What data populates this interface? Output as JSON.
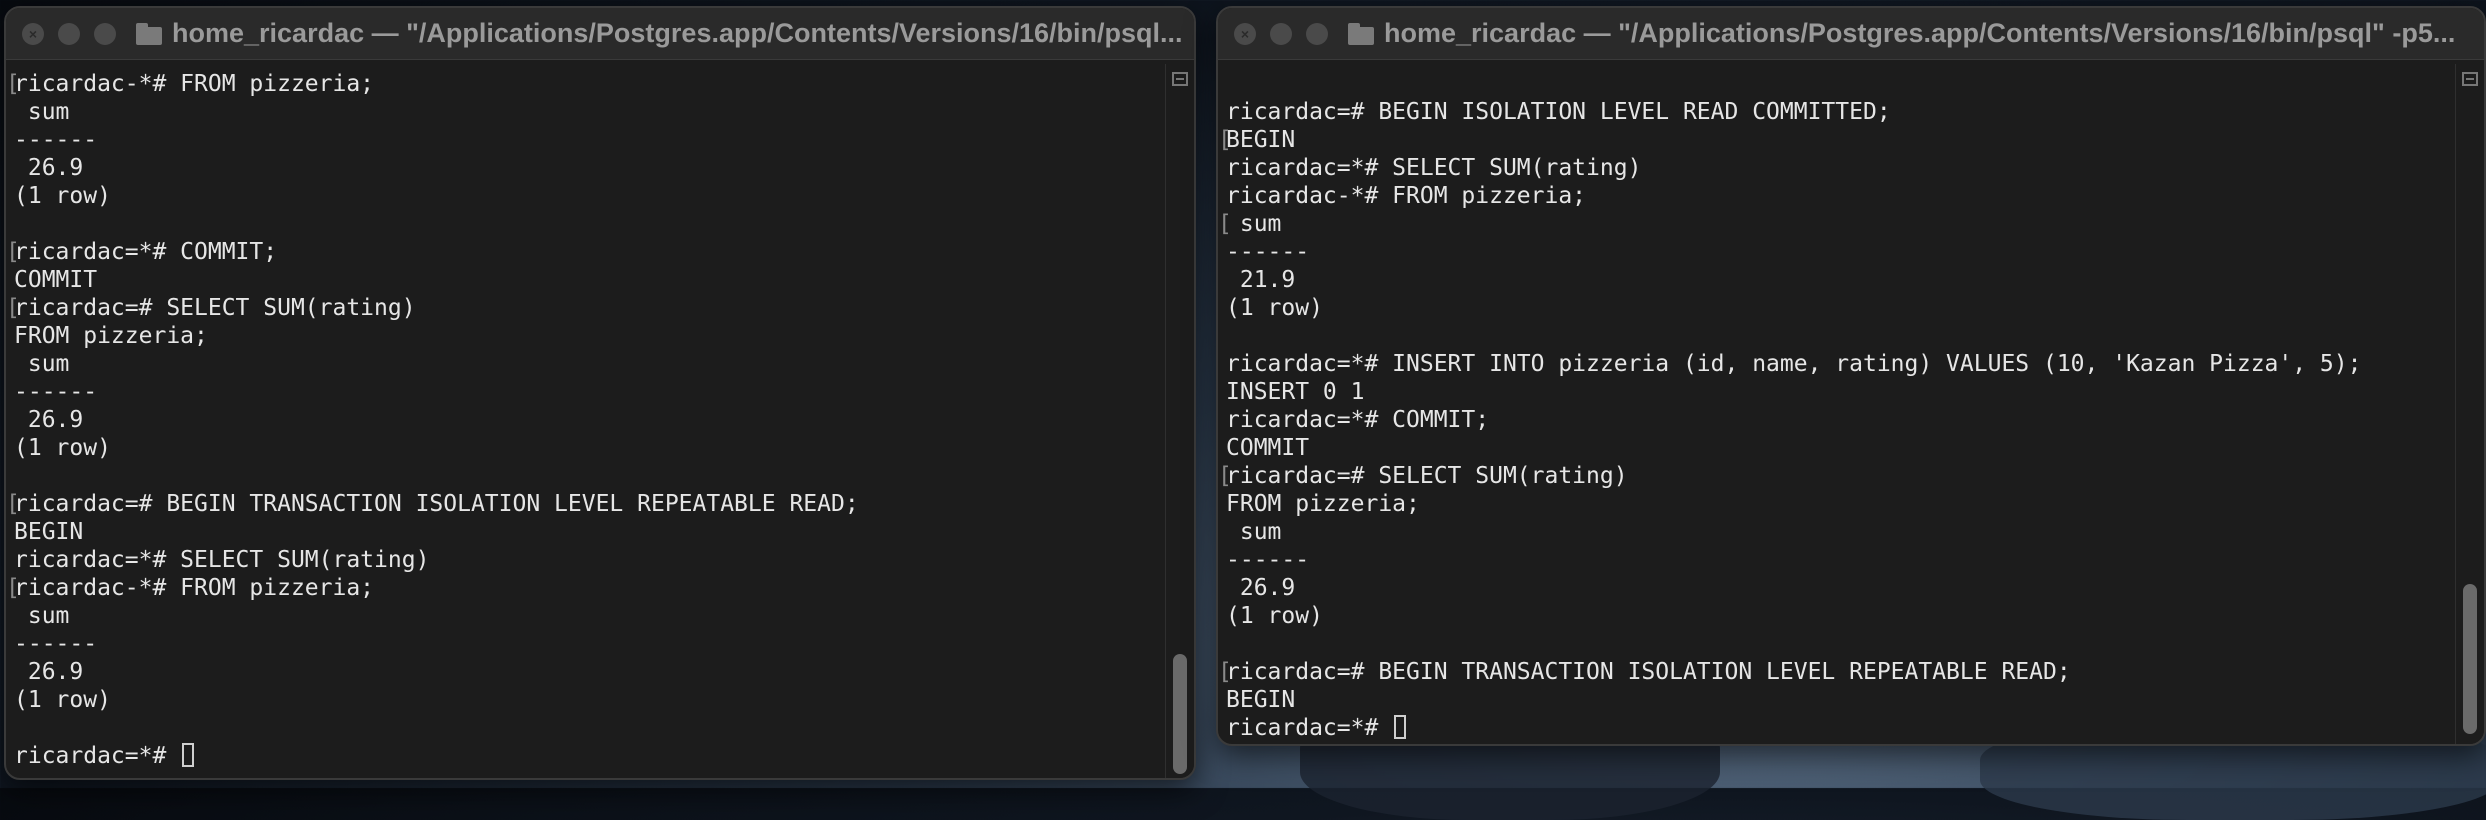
{
  "windows": [
    {
      "title": "home_ricardac — \"/Applications/Postgres.app/Contents/Versions/16/bin/psql...",
      "lines": [
        {
          "text": "ricardac-*# FROM pizzeria;",
          "bracket": true
        },
        {
          "text": " sum",
          "bracket": false
        },
        {
          "text": "------",
          "bracket": false
        },
        {
          "text": " 26.9",
          "bracket": false
        },
        {
          "text": "(1 row)",
          "bracket": false
        },
        {
          "text": "",
          "bracket": false
        },
        {
          "text": "ricardac=*# COMMIT;",
          "bracket": true
        },
        {
          "text": "COMMIT",
          "bracket": false
        },
        {
          "text": "ricardac=# SELECT SUM(rating)",
          "bracket": true
        },
        {
          "text": "FROM pizzeria;",
          "bracket": false
        },
        {
          "text": " sum",
          "bracket": false
        },
        {
          "text": "------",
          "bracket": false
        },
        {
          "text": " 26.9",
          "bracket": false
        },
        {
          "text": "(1 row)",
          "bracket": false
        },
        {
          "text": "",
          "bracket": false
        },
        {
          "text": "ricardac=# BEGIN TRANSACTION ISOLATION LEVEL REPEATABLE READ;",
          "bracket": true
        },
        {
          "text": "BEGIN",
          "bracket": false
        },
        {
          "text": "ricardac=*# SELECT SUM(rating)",
          "bracket": false
        },
        {
          "text": "ricardac-*# FROM pizzeria;",
          "bracket": true
        },
        {
          "text": " sum",
          "bracket": false
        },
        {
          "text": "------",
          "bracket": false
        },
        {
          "text": " 26.9",
          "bracket": false
        },
        {
          "text": "(1 row)",
          "bracket": false
        },
        {
          "text": "",
          "bracket": false
        }
      ],
      "prompt": "ricardac=*# "
    },
    {
      "title": "home_ricardac — \"/Applications/Postgres.app/Contents/Versions/16/bin/psql\" -p5...",
      "lines": [
        {
          "text": "",
          "bracket": false
        },
        {
          "text": "ricardac=# BEGIN ISOLATION LEVEL READ COMMITTED;",
          "bracket": false
        },
        {
          "text": "BEGIN",
          "bracket": true
        },
        {
          "text": "ricardac=*# SELECT SUM(rating)",
          "bracket": false
        },
        {
          "text": "ricardac-*# FROM pizzeria;",
          "bracket": false
        },
        {
          "text": " sum",
          "bracket": true
        },
        {
          "text": "------",
          "bracket": false
        },
        {
          "text": " 21.9",
          "bracket": false
        },
        {
          "text": "(1 row)",
          "bracket": false
        },
        {
          "text": "",
          "bracket": false
        },
        {
          "text": "ricardac=*# INSERT INTO pizzeria (id, name, rating) VALUES (10, 'Kazan Pizza', 5);",
          "bracket": false
        },
        {
          "text": "INSERT 0 1",
          "bracket": false
        },
        {
          "text": "ricardac=*# COMMIT;",
          "bracket": false
        },
        {
          "text": "COMMIT",
          "bracket": false
        },
        {
          "text": "ricardac=# SELECT SUM(rating)",
          "bracket": true
        },
        {
          "text": "FROM pizzeria;",
          "bracket": false
        },
        {
          "text": " sum",
          "bracket": false
        },
        {
          "text": "------",
          "bracket": false
        },
        {
          "text": " 26.9",
          "bracket": false
        },
        {
          "text": "(1 row)",
          "bracket": false
        },
        {
          "text": "",
          "bracket": false
        },
        {
          "text": "ricardac=# BEGIN TRANSACTION ISOLATION LEVEL REPEATABLE READ;",
          "bracket": true
        },
        {
          "text": "BEGIN",
          "bracket": false
        }
      ],
      "prompt": "ricardac=*# "
    }
  ]
}
